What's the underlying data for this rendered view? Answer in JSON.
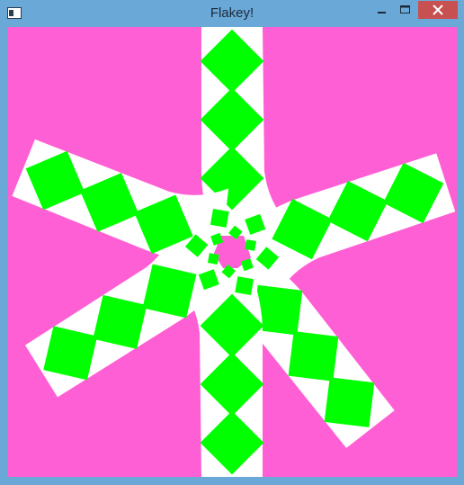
{
  "window": {
    "title": "Flakey!",
    "frame_color": "#6aa8d8",
    "close_button_color": "#c75050",
    "app_icon": "window-app-icon",
    "caption_icons": [
      "minimize-icon",
      "maximize-icon",
      "close-icon"
    ]
  },
  "canvas": {
    "background": "#ff5fd5",
    "arm_color": "#ffffff",
    "diamond_color": "#00ff00",
    "center_dot_color": "#ff5fd5",
    "arm_count": 6,
    "arm_rotations_deg": [
      0,
      72,
      142,
      180,
      238,
      292
    ]
  }
}
